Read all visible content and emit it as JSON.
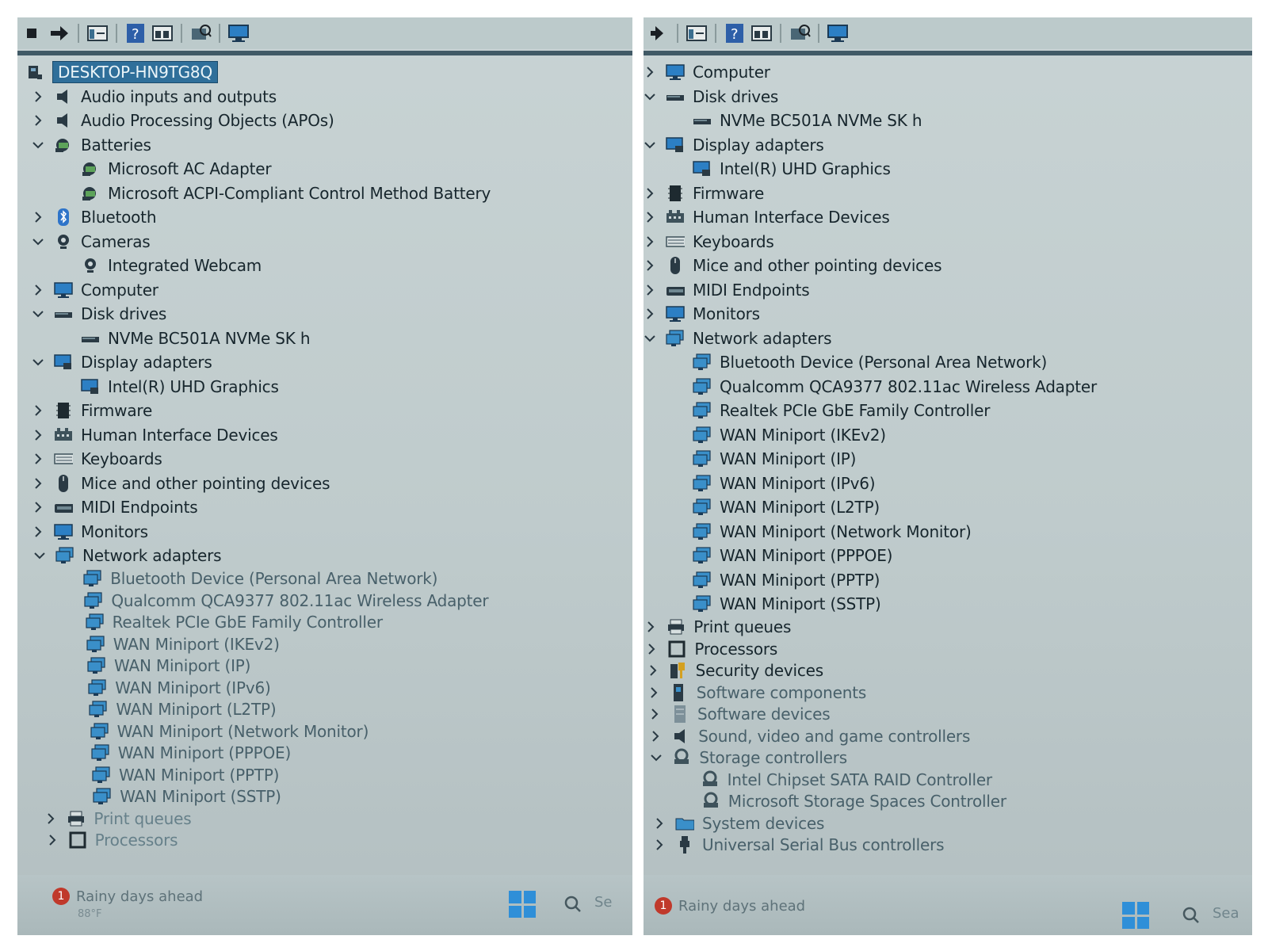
{
  "left": {
    "root": "DESKTOP-HN9TG8Q",
    "items": [
      {
        "label": "Audio inputs and outputs",
        "level": 1,
        "expand": "collapsed",
        "icon": "speaker-icon"
      },
      {
        "label": "Audio Processing Objects (APOs)",
        "level": 1,
        "expand": "collapsed",
        "icon": "speaker-icon"
      },
      {
        "label": "Batteries",
        "level": 1,
        "expand": "expanded",
        "icon": "battery-icon"
      },
      {
        "label": "Microsoft AC Adapter",
        "level": 2,
        "expand": "none",
        "icon": "battery-icon"
      },
      {
        "label": "Microsoft ACPI-Compliant Control Method Battery",
        "level": 2,
        "expand": "none",
        "icon": "battery-icon"
      },
      {
        "label": "Bluetooth",
        "level": 1,
        "expand": "collapsed",
        "icon": "bluetooth-icon"
      },
      {
        "label": "Cameras",
        "level": 1,
        "expand": "expanded",
        "icon": "camera-icon"
      },
      {
        "label": "Integrated Webcam",
        "level": 2,
        "expand": "none",
        "icon": "camera-icon"
      },
      {
        "label": "Computer",
        "level": 1,
        "expand": "collapsed",
        "icon": "monitor-icon"
      },
      {
        "label": "Disk drives",
        "level": 1,
        "expand": "expanded",
        "icon": "disk-icon"
      },
      {
        "label": "NVMe BC501A NVMe SK h",
        "level": 2,
        "expand": "none",
        "icon": "disk-icon"
      },
      {
        "label": "Display adapters",
        "level": 1,
        "expand": "expanded",
        "icon": "display-adapter-icon"
      },
      {
        "label": "Intel(R) UHD Graphics",
        "level": 2,
        "expand": "none",
        "icon": "display-adapter-icon"
      },
      {
        "label": "Firmware",
        "level": 1,
        "expand": "collapsed",
        "icon": "chip-icon"
      },
      {
        "label": "Human Interface Devices",
        "level": 1,
        "expand": "collapsed",
        "icon": "hid-icon"
      },
      {
        "label": "Keyboards",
        "level": 1,
        "expand": "collapsed",
        "icon": "keyboard-icon"
      },
      {
        "label": "Mice and other pointing devices",
        "level": 1,
        "expand": "collapsed",
        "icon": "mouse-icon"
      },
      {
        "label": "MIDI Endpoints",
        "level": 1,
        "expand": "collapsed",
        "icon": "midi-icon"
      },
      {
        "label": "Monitors",
        "level": 1,
        "expand": "collapsed",
        "icon": "monitor-icon"
      },
      {
        "label": "Network adapters",
        "level": 1,
        "expand": "expanded",
        "icon": "network-icon"
      },
      {
        "label": "Bluetooth Device (Personal Area Network)",
        "level": 2,
        "expand": "none",
        "icon": "network-icon"
      },
      {
        "label": "Qualcomm QCA9377 802.11ac Wireless Adapter",
        "level": 2,
        "expand": "none",
        "icon": "network-icon"
      },
      {
        "label": "Realtek PCIe GbE Family Controller",
        "level": 2,
        "expand": "none",
        "icon": "network-icon"
      },
      {
        "label": "WAN Miniport (IKEv2)",
        "level": 2,
        "expand": "none",
        "icon": "network-icon"
      },
      {
        "label": "WAN Miniport (IP)",
        "level": 2,
        "expand": "none",
        "icon": "network-icon"
      },
      {
        "label": "WAN Miniport (IPv6)",
        "level": 2,
        "expand": "none",
        "icon": "network-icon"
      },
      {
        "label": "WAN Miniport (L2TP)",
        "level": 2,
        "expand": "none",
        "icon": "network-icon"
      },
      {
        "label": "WAN Miniport (Network Monitor)",
        "level": 2,
        "expand": "none",
        "icon": "network-icon"
      },
      {
        "label": "WAN Miniport (PPPOE)",
        "level": 2,
        "expand": "none",
        "icon": "network-icon"
      },
      {
        "label": "WAN Miniport (PPTP)",
        "level": 2,
        "expand": "none",
        "icon": "network-icon"
      },
      {
        "label": "WAN Miniport (SSTP)",
        "level": 2,
        "expand": "none",
        "icon": "network-icon"
      },
      {
        "label": "Print queues",
        "level": 1,
        "expand": "collapsed",
        "icon": "printer-icon"
      },
      {
        "label": "Processors",
        "level": 1,
        "expand": "collapsed",
        "icon": "processor-icon"
      }
    ],
    "taskbar": {
      "weather": "Rainy days ahead",
      "temp": "88°F",
      "badge": "1",
      "search": "Se"
    }
  },
  "right": {
    "items": [
      {
        "label": "Computer",
        "level": 1,
        "expand": "collapsed",
        "icon": "monitor-icon"
      },
      {
        "label": "Disk drives",
        "level": 1,
        "expand": "expanded",
        "icon": "disk-icon"
      },
      {
        "label": "NVMe BC501A NVMe SK h",
        "level": 2,
        "expand": "none",
        "icon": "disk-icon"
      },
      {
        "label": "Display adapters",
        "level": 1,
        "expand": "expanded",
        "icon": "display-adapter-icon"
      },
      {
        "label": "Intel(R) UHD Graphics",
        "level": 2,
        "expand": "none",
        "icon": "display-adapter-icon"
      },
      {
        "label": "Firmware",
        "level": 1,
        "expand": "collapsed",
        "icon": "chip-icon"
      },
      {
        "label": "Human Interface Devices",
        "level": 1,
        "expand": "collapsed",
        "icon": "hid-icon"
      },
      {
        "label": "Keyboards",
        "level": 1,
        "expand": "collapsed",
        "icon": "keyboard-icon"
      },
      {
        "label": "Mice and other pointing devices",
        "level": 1,
        "expand": "collapsed",
        "icon": "mouse-icon"
      },
      {
        "label": "MIDI Endpoints",
        "level": 1,
        "expand": "collapsed",
        "icon": "midi-icon"
      },
      {
        "label": "Monitors",
        "level": 1,
        "expand": "collapsed",
        "icon": "monitor-icon"
      },
      {
        "label": "Network adapters",
        "level": 1,
        "expand": "expanded",
        "icon": "network-icon"
      },
      {
        "label": "Bluetooth Device (Personal Area Network)",
        "level": 2,
        "expand": "none",
        "icon": "network-icon"
      },
      {
        "label": "Qualcomm QCA9377 802.11ac Wireless Adapter",
        "level": 2,
        "expand": "none",
        "icon": "network-icon"
      },
      {
        "label": "Realtek PCIe GbE Family Controller",
        "level": 2,
        "expand": "none",
        "icon": "network-icon"
      },
      {
        "label": "WAN Miniport (IKEv2)",
        "level": 2,
        "expand": "none",
        "icon": "network-icon"
      },
      {
        "label": "WAN Miniport (IP)",
        "level": 2,
        "expand": "none",
        "icon": "network-icon"
      },
      {
        "label": "WAN Miniport (IPv6)",
        "level": 2,
        "expand": "none",
        "icon": "network-icon"
      },
      {
        "label": "WAN Miniport (L2TP)",
        "level": 2,
        "expand": "none",
        "icon": "network-icon"
      },
      {
        "label": "WAN Miniport (Network Monitor)",
        "level": 2,
        "expand": "none",
        "icon": "network-icon"
      },
      {
        "label": "WAN Miniport (PPPOE)",
        "level": 2,
        "expand": "none",
        "icon": "network-icon"
      },
      {
        "label": "WAN Miniport (PPTP)",
        "level": 2,
        "expand": "none",
        "icon": "network-icon"
      },
      {
        "label": "WAN Miniport (SSTP)",
        "level": 2,
        "expand": "none",
        "icon": "network-icon"
      },
      {
        "label": "Print queues",
        "level": 1,
        "expand": "collapsed",
        "icon": "printer-icon"
      },
      {
        "label": "Processors",
        "level": 1,
        "expand": "collapsed",
        "icon": "processor-icon"
      },
      {
        "label": "Security devices",
        "level": 1,
        "expand": "collapsed",
        "icon": "security-icon"
      },
      {
        "label": "Software components",
        "level": 1,
        "expand": "collapsed",
        "icon": "software-component-icon"
      },
      {
        "label": "Software devices",
        "level": 1,
        "expand": "collapsed",
        "icon": "software-device-icon"
      },
      {
        "label": "Sound, video and game controllers",
        "level": 1,
        "expand": "collapsed",
        "icon": "speaker-icon"
      },
      {
        "label": "Storage controllers",
        "level": 1,
        "expand": "expanded",
        "icon": "storage-controller-icon"
      },
      {
        "label": "Intel Chipset SATA RAID Controller",
        "level": 2,
        "expand": "none",
        "icon": "storage-controller-icon"
      },
      {
        "label": "Microsoft Storage Spaces Controller",
        "level": 2,
        "expand": "none",
        "icon": "storage-controller-icon"
      },
      {
        "label": "System devices",
        "level": 1,
        "expand": "collapsed",
        "icon": "folder-icon"
      },
      {
        "label": "Universal Serial Bus controllers",
        "level": 1,
        "expand": "collapsed",
        "icon": "usb-icon"
      }
    ],
    "taskbar": {
      "weather": "Rainy days ahead",
      "badge": "1",
      "search": "Sea"
    }
  },
  "toolbar": {
    "buttons": [
      "back-icon",
      "forward-icon",
      "properties-icon",
      "help-icon",
      "view-icon",
      "scan-hardware-icon",
      "monitor-icon"
    ]
  },
  "colors": {
    "panel_bg": "#c3cfd0",
    "text": "#17262d",
    "selection": "#2f6f9a",
    "network_icon": "#3a8fc9",
    "divider": "#415a66"
  }
}
